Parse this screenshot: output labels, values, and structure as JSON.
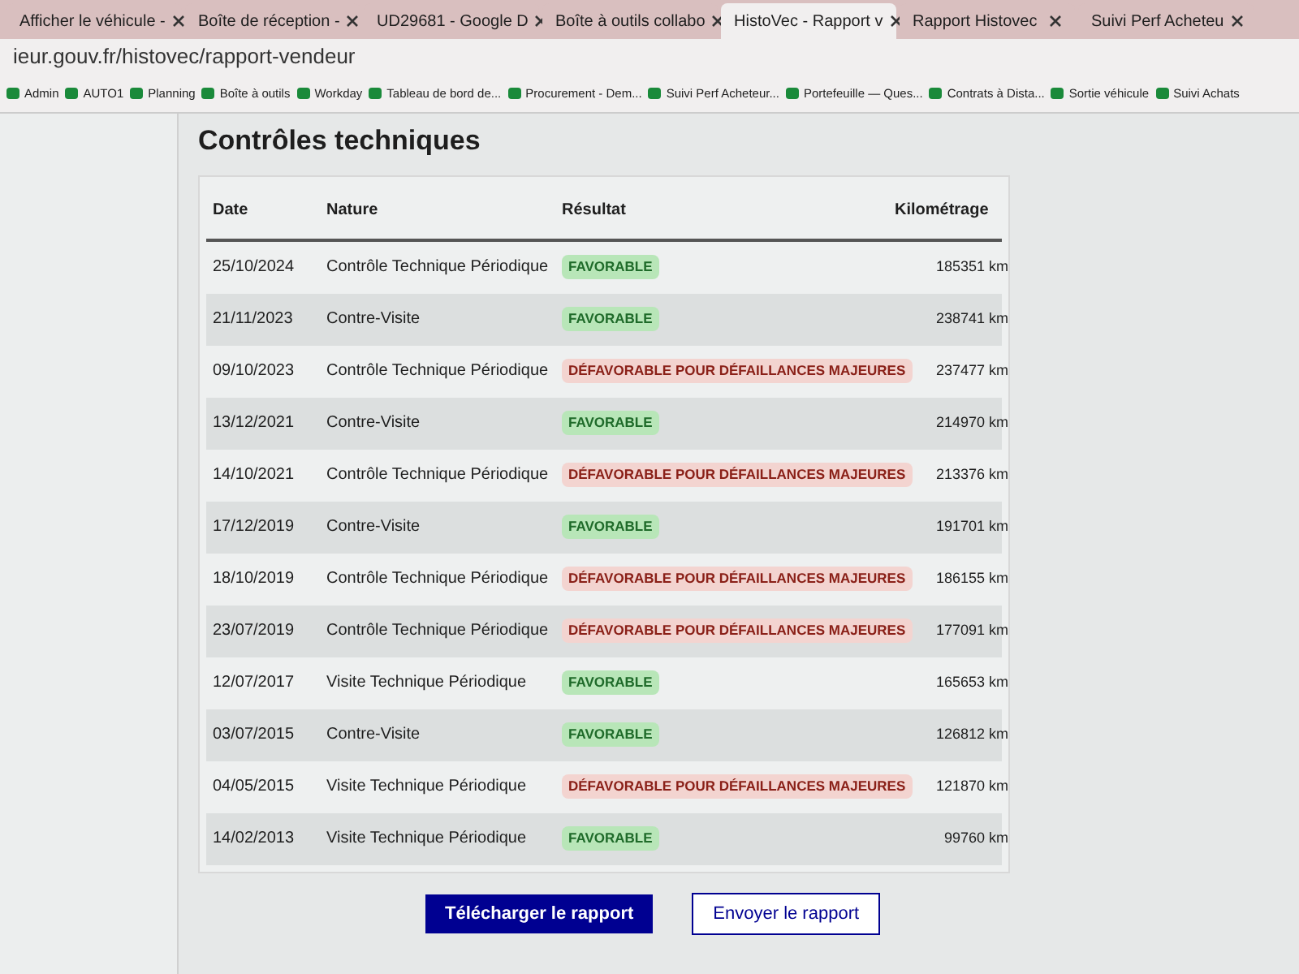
{
  "browser": {
    "tabs": [
      {
        "title": "Afficher le véhicule -",
        "selected": false
      },
      {
        "title": "Boîte de réception - ",
        "selected": false
      },
      {
        "title": "UD29681 - Google D",
        "selected": false
      },
      {
        "title": "Boîte à outils collabo",
        "selected": false
      },
      {
        "title": "HistoVec - Rapport v",
        "selected": true
      },
      {
        "title": "Rapport Histovec",
        "selected": false
      },
      {
        "title": "Suivi Perf Acheteu",
        "selected": false
      }
    ],
    "address": "ieur.gouv.fr/histovec/rapport-vendeur",
    "bookmarks": [
      "Admin",
      "AUTO1",
      "Planning",
      "Boîte à outils",
      "Workday",
      "Tableau de bord de...",
      "Procurement - Dem...",
      "Suivi Perf Acheteur...",
      "Portefeuille — Ques...",
      "Contrats à Dista...",
      "Sortie véhicule",
      "Suivi Achats"
    ]
  },
  "section": {
    "title": "Contrôles techniques",
    "columns": [
      "Date",
      "Nature",
      "Résultat",
      "Kilométrage"
    ],
    "rows": [
      {
        "date": "25/10/2024",
        "nature": "Contrôle Technique Périodique",
        "result": "FAVORABLE",
        "kind": "favorable",
        "km": "185351 km"
      },
      {
        "date": "21/11/2023",
        "nature": "Contre-Visite",
        "result": "FAVORABLE",
        "kind": "favorable",
        "km": "238741 km"
      },
      {
        "date": "09/10/2023",
        "nature": "Contrôle Technique Périodique",
        "result": "DÉFAVORABLE POUR DÉFAILLANCES MAJEURES",
        "kind": "defavorable",
        "km": "237477 km"
      },
      {
        "date": "13/12/2021",
        "nature": "Contre-Visite",
        "result": "FAVORABLE",
        "kind": "favorable",
        "km": "214970 km"
      },
      {
        "date": "14/10/2021",
        "nature": "Contrôle Technique Périodique",
        "result": "DÉFAVORABLE POUR DÉFAILLANCES MAJEURES",
        "kind": "defavorable",
        "km": "213376 km"
      },
      {
        "date": "17/12/2019",
        "nature": "Contre-Visite",
        "result": "FAVORABLE",
        "kind": "favorable",
        "km": "191701 km"
      },
      {
        "date": "18/10/2019",
        "nature": "Contrôle Technique Périodique",
        "result": "DÉFAVORABLE POUR DÉFAILLANCES MAJEURES",
        "kind": "defavorable",
        "km": "186155 km"
      },
      {
        "date": "23/07/2019",
        "nature": "Contrôle Technique Périodique",
        "result": "DÉFAVORABLE POUR DÉFAILLANCES MAJEURES",
        "kind": "defavorable",
        "km": "177091 km"
      },
      {
        "date": "12/07/2017",
        "nature": "Visite Technique Périodique",
        "result": "FAVORABLE",
        "kind": "favorable",
        "km": "165653 km"
      },
      {
        "date": "03/07/2015",
        "nature": "Contre-Visite",
        "result": "FAVORABLE",
        "kind": "favorable",
        "km": "126812 km"
      },
      {
        "date": "04/05/2015",
        "nature": "Visite Technique Périodique",
        "result": "DÉFAVORABLE POUR DÉFAILLANCES MAJEURES",
        "kind": "defavorable",
        "km": "121870 km"
      },
      {
        "date": "14/02/2013",
        "nature": "Visite Technique Périodique",
        "result": "FAVORABLE",
        "kind": "favorable",
        "km": "99760 km"
      }
    ]
  },
  "actions": [
    "Télécharger le rapport",
    "Envoyer le rapport"
  ]
}
